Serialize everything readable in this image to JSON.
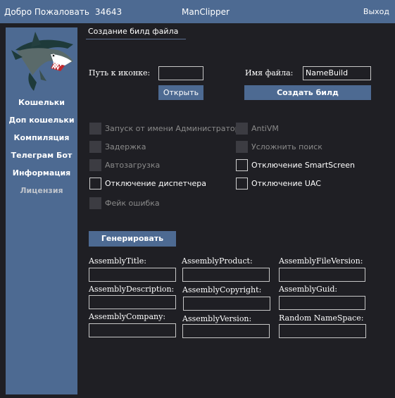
{
  "titlebar": {
    "welcome": "Добро Пожаловать",
    "user_id": "34643",
    "app_title": "ManClipper",
    "exit": "Выход"
  },
  "sidebar": {
    "logo_icon": "shark-logo-icon",
    "items": [
      {
        "label": "Кошельки"
      },
      {
        "label": "Доп кошельки"
      },
      {
        "label": "Компиляция"
      },
      {
        "label": "Телеграм Бот"
      },
      {
        "label": "Информация"
      },
      {
        "label": "Лицензия"
      }
    ]
  },
  "main": {
    "section_title": "Создание билд файла",
    "icon_path_label": "Путь к иконке:",
    "icon_path_value": "",
    "open_button": "Открыть",
    "file_name_label": "Имя файла:",
    "file_name_value": "NameBuild",
    "create_build_button": "Создать билд",
    "options_left": [
      {
        "label": "Запуск от имени Администратора",
        "enabled": false
      },
      {
        "label": "Задержка",
        "enabled": false
      },
      {
        "label": "Автозагрузка",
        "enabled": false
      },
      {
        "label": "Отключение диспетчера",
        "enabled": true
      },
      {
        "label": "Фейк ошибка",
        "enabled": false
      }
    ],
    "options_right": [
      {
        "label": "AntiVM",
        "enabled": false
      },
      {
        "label": "Усложнить поиск",
        "enabled": false
      },
      {
        "label": "Отключение SmartScreen",
        "enabled": true
      },
      {
        "label": "Отключение UAC",
        "enabled": true
      }
    ],
    "generate_button": "Генерировать",
    "assembly": {
      "title_label": "AssemblyTitle:",
      "product_label": "AssemblyProduct:",
      "file_version_label": "AssemblyFileVersion:",
      "description_label": "AssemblyDescription:",
      "copyright_label": "AssemblyCopyright:",
      "guid_label": "AssemblyGuid:",
      "company_label": "AssemblyCompany:",
      "version_label": "AssemblyVersion:",
      "namespace_label": "Random NameSpace:",
      "title_value": "",
      "product_value": "",
      "file_version_value": "",
      "description_value": "",
      "copyright_value": "",
      "guid_value": "",
      "company_value": "",
      "version_value": "",
      "namespace_value": ""
    }
  },
  "colors": {
    "accent": "#4d6a92",
    "background": "#1f1f24",
    "checkbox_disabled": "#3c3c42"
  }
}
